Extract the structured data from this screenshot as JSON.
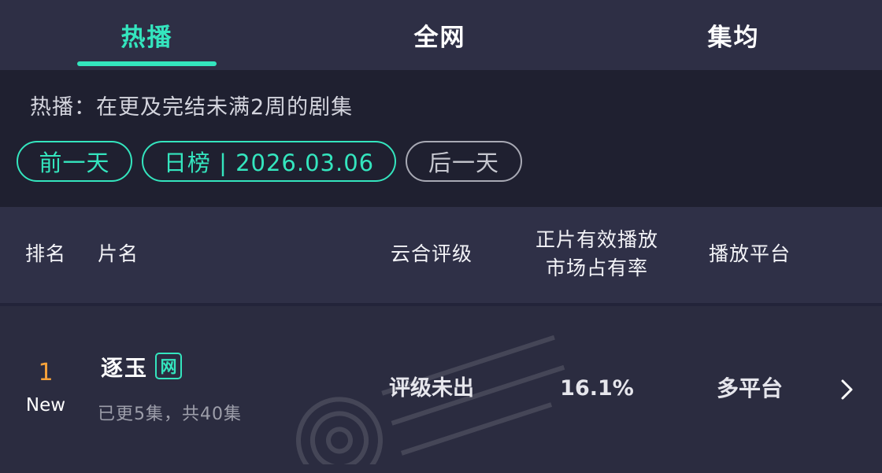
{
  "tabs": [
    {
      "label": "热播",
      "active": true
    },
    {
      "label": "全网",
      "active": false
    },
    {
      "label": "集均",
      "active": false
    }
  ],
  "description": "热播：在更及完结未满2周的剧集",
  "date_nav": {
    "prev_label": "前一天",
    "current_label": "日榜 | 2026.03.06",
    "next_label": "后一天"
  },
  "table": {
    "headers": {
      "rank": "排名",
      "title": "片名",
      "rating": "云合评级",
      "share_line1": "正片有效播放",
      "share_line2": "市场占有率",
      "platform": "播放平台"
    },
    "rows": [
      {
        "rank": "1",
        "badge": "New",
        "title": "逐玉",
        "title_tag": "网",
        "episodes": "已更5集，共40集",
        "rating": "评级未出",
        "share": "16.1%",
        "platform": "多平台"
      }
    ]
  },
  "colors": {
    "accent": "#34e5be",
    "rank_orange": "#f7a23a",
    "background": "#2b2c40"
  },
  "icons": {
    "row_chevron": "chevron-right-icon",
    "watermark": "enlightent-watermark-logo"
  }
}
